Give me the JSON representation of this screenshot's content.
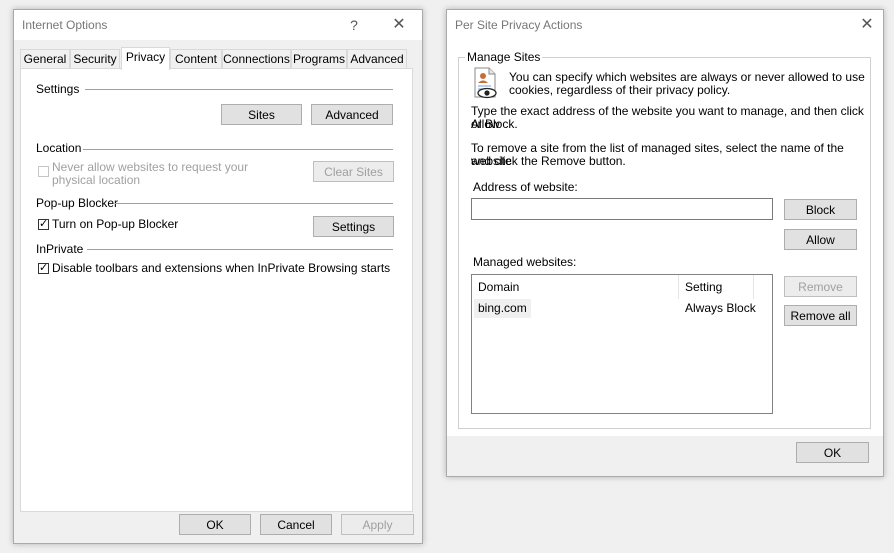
{
  "internet_options": {
    "title": "Internet Options",
    "help": "?",
    "close": "✕",
    "tabs": [
      "General",
      "Security",
      "Privacy",
      "Content",
      "Connections",
      "Programs",
      "Advanced"
    ],
    "active_tab": "Privacy",
    "settings": {
      "label": "Settings",
      "sites": "Sites",
      "advanced": "Advanced"
    },
    "location": {
      "label": "Location",
      "never_allow": "Never allow websites to request your",
      "never_allow2": "physical location",
      "clear_sites": "Clear Sites"
    },
    "popup": {
      "label": "Pop-up Blocker",
      "turn_on": "Turn on Pop-up Blocker",
      "settings": "Settings"
    },
    "inprivate": {
      "label": "InPrivate",
      "disable": "Disable toolbars and extensions when InPrivate Browsing starts"
    },
    "footer": {
      "ok": "OK",
      "cancel": "Cancel",
      "apply": "Apply"
    }
  },
  "per_site": {
    "title": "Per Site Privacy Actions",
    "close": "✕",
    "manage_sites": "Manage Sites",
    "intro1": "You can specify which websites are always or never allowed to use",
    "intro2": "cookies, regardless of their privacy policy.",
    "type1": "Type the exact address of the website you want to manage, and then click Allow",
    "type2": "or Block.",
    "remove1": "To remove a site from the list of managed sites, select the name of the website",
    "remove2": "and click the Remove button.",
    "address_label": "Address of website:",
    "address_value": "",
    "block": "Block",
    "allow": "Allow",
    "managed_label": "Managed websites:",
    "columns": [
      "Domain",
      "Setting"
    ],
    "rows": [
      {
        "domain": "bing.com",
        "setting": "Always Block"
      }
    ],
    "remove": "Remove",
    "remove_all": "Remove all",
    "ok": "OK"
  }
}
